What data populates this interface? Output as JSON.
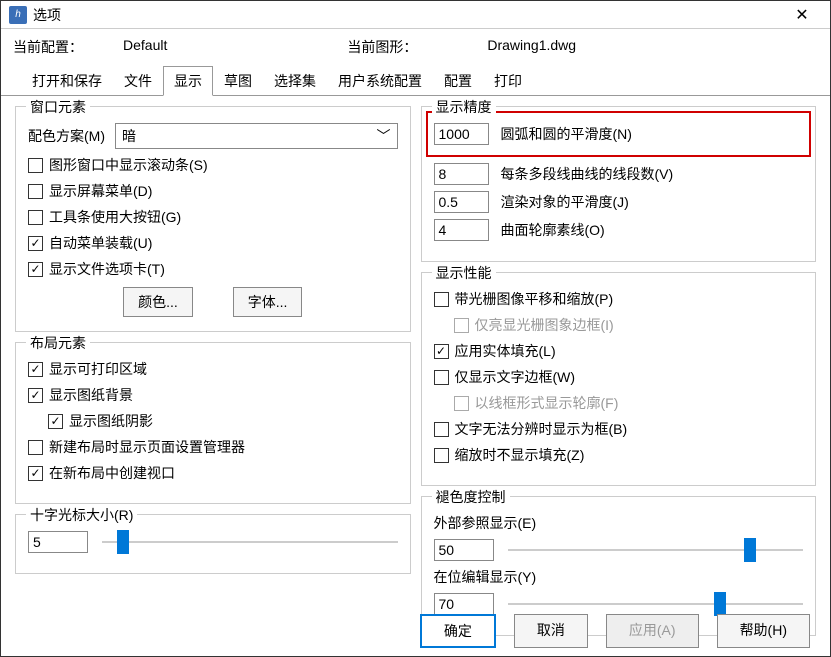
{
  "title": "选项",
  "info": {
    "config_label": "当前配置：",
    "config_value": "Default",
    "drawing_label": "当前图形：",
    "drawing_value": "Drawing1.dwg"
  },
  "tabs": [
    "打开和保存",
    "文件",
    "显示",
    "草图",
    "选择集",
    "用户系统配置",
    "配置",
    "打印"
  ],
  "window_elements": {
    "title": "窗口元素",
    "scheme_label": "配色方案(M)",
    "scheme_value": "暗",
    "scrollbar": "图形窗口中显示滚动条(S)",
    "screen_menu": "显示屏幕菜单(D)",
    "big_buttons": "工具条使用大按钮(G)",
    "auto_menu": "自动菜单装载(U)",
    "file_tabs": "显示文件选项卡(T)",
    "color_btn": "颜色...",
    "font_btn": "字体..."
  },
  "layout_elements": {
    "title": "布局元素",
    "printable": "显示可打印区域",
    "paper_bg": "显示图纸背景",
    "paper_shadow": "显示图纸阴影",
    "page_setup": "新建布局时显示页面设置管理器",
    "viewport": "在新布局中创建视口"
  },
  "crosshair": {
    "title": "十字光标大小(R)",
    "value": "5"
  },
  "precision": {
    "title": "显示精度",
    "arc_val": "1000",
    "arc_label": "圆弧和圆的平滑度(N)",
    "seg_val": "8",
    "seg_label": "每条多段线曲线的线段数(V)",
    "render_val": "0.5",
    "render_label": "渲染对象的平滑度(J)",
    "contour_val": "4",
    "contour_label": "曲面轮廓素线(O)"
  },
  "performance": {
    "title": "显示性能",
    "raster_pan": "带光栅图像平移和缩放(P)",
    "highlight_raster": "仅亮显光栅图象边框(I)",
    "solid_fill": "应用实体填充(L)",
    "text_frame": "仅显示文字边框(W)",
    "wireframe": "以线框形式显示轮廓(F)",
    "text_box": "文字无法分辨时显示为框(B)",
    "no_fill_zoom": "缩放时不显示填充(Z)"
  },
  "fade": {
    "title": "褪色度控制",
    "xref_label": "外部参照显示(E)",
    "xref_value": "50",
    "edit_label": "在位编辑显示(Y)",
    "edit_value": "70"
  },
  "buttons": {
    "ok": "确定",
    "cancel": "取消",
    "apply": "应用(A)",
    "help": "帮助(H)"
  }
}
